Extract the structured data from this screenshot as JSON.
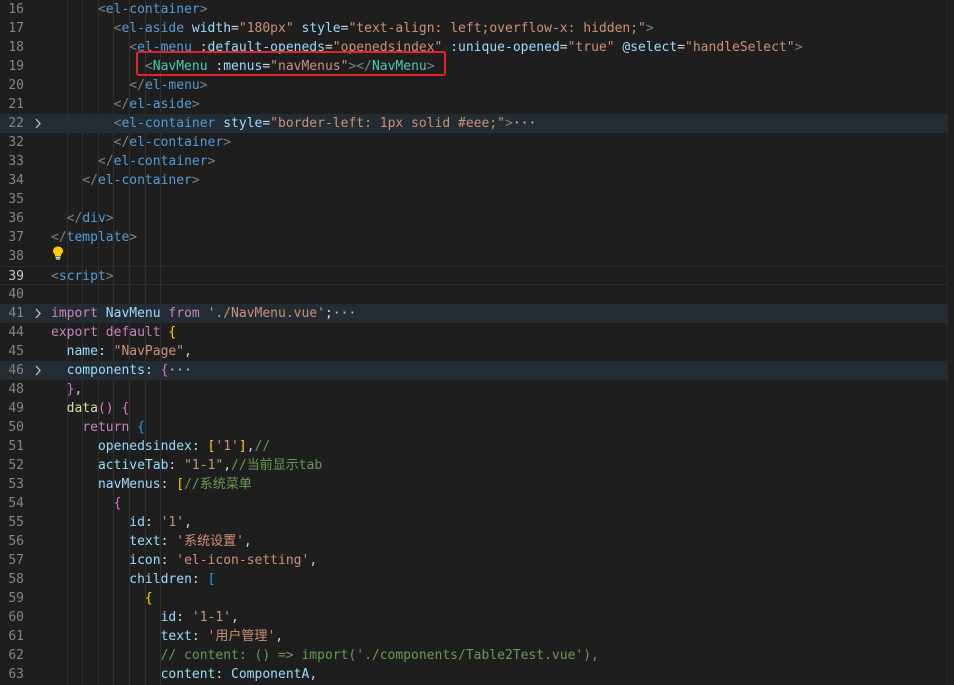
{
  "editor": {
    "lines": [
      {
        "num": "16",
        "fold": "",
        "tokens": [
          [
            "i",
            "      "
          ],
          [
            "br",
            "<"
          ],
          [
            "tag",
            "el-container"
          ],
          [
            "br",
            ">"
          ]
        ]
      },
      {
        "num": "17",
        "fold": "",
        "tokens": [
          [
            "i",
            "        "
          ],
          [
            "br",
            "<"
          ],
          [
            "tag",
            "el-aside"
          ],
          [
            "txt",
            " "
          ],
          [
            "attr",
            "width"
          ],
          [
            "txt",
            "="
          ],
          [
            "str",
            "\"180px\""
          ],
          [
            "txt",
            " "
          ],
          [
            "attr",
            "style"
          ],
          [
            "txt",
            "="
          ],
          [
            "str",
            "\"text-align: left;overflow-x: hidden;\""
          ],
          [
            "br",
            ">"
          ]
        ]
      },
      {
        "num": "18",
        "fold": "",
        "tokens": [
          [
            "i",
            "          "
          ],
          [
            "br",
            "<"
          ],
          [
            "tag",
            "el-menu"
          ],
          [
            "txt",
            " "
          ],
          [
            "attr",
            ":default-openeds"
          ],
          [
            "txt",
            "="
          ],
          [
            "str",
            "\"openedsindex\""
          ],
          [
            "txt",
            " "
          ],
          [
            "attr",
            ":unique-opened"
          ],
          [
            "txt",
            "="
          ],
          [
            "str",
            "\"true\""
          ],
          [
            "txt",
            " "
          ],
          [
            "attr",
            "@select"
          ],
          [
            "txt",
            "="
          ],
          [
            "str",
            "\"handleSelect\""
          ],
          [
            "br",
            ">"
          ]
        ]
      },
      {
        "num": "19",
        "fold": "",
        "tokens": [
          [
            "i",
            "            "
          ],
          [
            "br",
            "<"
          ],
          [
            "cls",
            "NavMenu"
          ],
          [
            "txt",
            " "
          ],
          [
            "attr",
            ":menus"
          ],
          [
            "txt",
            "="
          ],
          [
            "str",
            "\"navMenus\""
          ],
          [
            "br",
            "></"
          ],
          [
            "cls",
            "NavMenu"
          ],
          [
            "br",
            ">"
          ]
        ]
      },
      {
        "num": "20",
        "fold": "",
        "tokens": [
          [
            "i",
            "          "
          ],
          [
            "br",
            "</"
          ],
          [
            "tag",
            "el-menu"
          ],
          [
            "br",
            ">"
          ]
        ]
      },
      {
        "num": "21",
        "fold": "",
        "tokens": [
          [
            "i",
            "        "
          ],
          [
            "br",
            "</"
          ],
          [
            "tag",
            "el-aside"
          ],
          [
            "br",
            ">"
          ]
        ]
      },
      {
        "num": "22",
        "fold": ">",
        "hl": true,
        "tokens": [
          [
            "i",
            "        "
          ],
          [
            "br",
            "<"
          ],
          [
            "tag",
            "el-container"
          ],
          [
            "txt",
            " "
          ],
          [
            "attr",
            "style"
          ],
          [
            "txt",
            "="
          ],
          [
            "str",
            "\"border-left: 1px solid #eee;\""
          ],
          [
            "br",
            ">"
          ],
          [
            "ell",
            "···"
          ]
        ]
      },
      {
        "num": "32",
        "fold": "",
        "tokens": [
          [
            "i",
            "        "
          ],
          [
            "br",
            "</"
          ],
          [
            "tag",
            "el-container"
          ],
          [
            "br",
            ">"
          ]
        ]
      },
      {
        "num": "33",
        "fold": "",
        "tokens": [
          [
            "i",
            "      "
          ],
          [
            "br",
            "</"
          ],
          [
            "tag",
            "el-container"
          ],
          [
            "br",
            ">"
          ]
        ]
      },
      {
        "num": "34",
        "fold": "",
        "tokens": [
          [
            "i",
            "    "
          ],
          [
            "br",
            "</"
          ],
          [
            "tag",
            "el-container"
          ],
          [
            "br",
            ">"
          ]
        ]
      },
      {
        "num": "35",
        "fold": "",
        "tokens": []
      },
      {
        "num": "36",
        "fold": "",
        "tokens": [
          [
            "i",
            "  "
          ],
          [
            "br",
            "</"
          ],
          [
            "tag",
            "div"
          ],
          [
            "br",
            ">"
          ]
        ]
      },
      {
        "num": "37",
        "fold": "",
        "tokens": [
          [
            "br",
            "</"
          ],
          [
            "tag",
            "template"
          ],
          [
            "br",
            ">"
          ]
        ]
      },
      {
        "num": "38",
        "fold": "",
        "tokens": []
      },
      {
        "num": "39",
        "fold": "",
        "active": true,
        "cursor": true,
        "tokens": [
          [
            "br",
            "<"
          ],
          [
            "tag",
            "script"
          ],
          [
            "br",
            ">"
          ]
        ]
      },
      {
        "num": "40",
        "fold": "",
        "tokens": []
      },
      {
        "num": "41",
        "fold": ">",
        "hl": true,
        "tokens": [
          [
            "kw",
            "import"
          ],
          [
            "txt",
            " "
          ],
          [
            "var",
            "NavMenu"
          ],
          [
            "txt",
            " "
          ],
          [
            "kw",
            "from"
          ],
          [
            "txt",
            " "
          ],
          [
            "str",
            "'./NavMenu.vue'"
          ],
          [
            "txt",
            ";"
          ],
          [
            "ell",
            "···"
          ]
        ]
      },
      {
        "num": "44",
        "fold": "",
        "tokens": [
          [
            "kw",
            "export"
          ],
          [
            "txt",
            " "
          ],
          [
            "kw",
            "default"
          ],
          [
            "txt",
            " "
          ],
          [
            "p1",
            "{"
          ]
        ]
      },
      {
        "num": "45",
        "fold": "",
        "tokens": [
          [
            "i",
            "  "
          ],
          [
            "var",
            "name"
          ],
          [
            "txt",
            ": "
          ],
          [
            "str",
            "\"NavPage\""
          ],
          [
            "txt",
            ","
          ]
        ]
      },
      {
        "num": "46",
        "fold": ">",
        "hl": true,
        "tokens": [
          [
            "i",
            "  "
          ],
          [
            "var",
            "components"
          ],
          [
            "txt",
            ": "
          ],
          [
            "p2",
            "{"
          ],
          [
            "ell",
            "···"
          ]
        ]
      },
      {
        "num": "48",
        "fold": "",
        "tokens": [
          [
            "i",
            "  "
          ],
          [
            "p2",
            "}"
          ],
          [
            "txt",
            ","
          ]
        ]
      },
      {
        "num": "49",
        "fold": "",
        "tokens": [
          [
            "i",
            "  "
          ],
          [
            "fn",
            "data"
          ],
          [
            "p2",
            "()"
          ],
          [
            "txt",
            " "
          ],
          [
            "p2",
            "{"
          ]
        ]
      },
      {
        "num": "50",
        "fold": "",
        "tokens": [
          [
            "i",
            "    "
          ],
          [
            "kw",
            "return"
          ],
          [
            "txt",
            " "
          ],
          [
            "p3",
            "{"
          ]
        ]
      },
      {
        "num": "51",
        "fold": "",
        "tokens": [
          [
            "i",
            "      "
          ],
          [
            "var",
            "openedsindex"
          ],
          [
            "txt",
            ": "
          ],
          [
            "p1",
            "["
          ],
          [
            "str",
            "'1'"
          ],
          [
            "p1",
            "]"
          ],
          [
            "txt",
            ","
          ],
          [
            "cm",
            "//"
          ]
        ]
      },
      {
        "num": "52",
        "fold": "",
        "tokens": [
          [
            "i",
            "      "
          ],
          [
            "var",
            "activeTab"
          ],
          [
            "txt",
            ": "
          ],
          [
            "str",
            "\"1-1\""
          ],
          [
            "txt",
            ","
          ],
          [
            "cm",
            "//当前显示tab"
          ]
        ]
      },
      {
        "num": "53",
        "fold": "",
        "tokens": [
          [
            "i",
            "      "
          ],
          [
            "var",
            "navMenus"
          ],
          [
            "txt",
            ": "
          ],
          [
            "p1",
            "["
          ],
          [
            "cm",
            "//系统菜单"
          ]
        ]
      },
      {
        "num": "54",
        "fold": "",
        "tokens": [
          [
            "i",
            "        "
          ],
          [
            "p2",
            "{"
          ]
        ]
      },
      {
        "num": "55",
        "fold": "",
        "tokens": [
          [
            "i",
            "          "
          ],
          [
            "var",
            "id"
          ],
          [
            "txt",
            ": "
          ],
          [
            "str",
            "'1'"
          ],
          [
            "txt",
            ","
          ]
        ]
      },
      {
        "num": "56",
        "fold": "",
        "tokens": [
          [
            "i",
            "          "
          ],
          [
            "var",
            "text"
          ],
          [
            "txt",
            ": "
          ],
          [
            "str",
            "'系统设置'"
          ],
          [
            "txt",
            ","
          ]
        ]
      },
      {
        "num": "57",
        "fold": "",
        "tokens": [
          [
            "i",
            "          "
          ],
          [
            "var",
            "icon"
          ],
          [
            "txt",
            ": "
          ],
          [
            "str",
            "'el-icon-setting'"
          ],
          [
            "txt",
            ","
          ]
        ]
      },
      {
        "num": "58",
        "fold": "",
        "tokens": [
          [
            "i",
            "          "
          ],
          [
            "var",
            "children"
          ],
          [
            "txt",
            ": "
          ],
          [
            "p3",
            "["
          ]
        ]
      },
      {
        "num": "59",
        "fold": "",
        "tokens": [
          [
            "i",
            "            "
          ],
          [
            "p1",
            "{"
          ]
        ]
      },
      {
        "num": "60",
        "fold": "",
        "tokens": [
          [
            "i",
            "              "
          ],
          [
            "var",
            "id"
          ],
          [
            "txt",
            ": "
          ],
          [
            "str",
            "'1-1'"
          ],
          [
            "txt",
            ","
          ]
        ]
      },
      {
        "num": "61",
        "fold": "",
        "tokens": [
          [
            "i",
            "              "
          ],
          [
            "var",
            "text"
          ],
          [
            "txt",
            ": "
          ],
          [
            "str",
            "'用户管理'"
          ],
          [
            "txt",
            ","
          ]
        ]
      },
      {
        "num": "62",
        "fold": "",
        "tokens": [
          [
            "i",
            "              "
          ],
          [
            "cm",
            "// content: () => import('./components/Table2Test.vue'),"
          ]
        ]
      },
      {
        "num": "63",
        "fold": "",
        "tokens": [
          [
            "i",
            "              "
          ],
          [
            "var",
            "content"
          ],
          [
            "txt",
            ": "
          ],
          [
            "var",
            "ComponentA"
          ],
          [
            "txt",
            ","
          ]
        ]
      }
    ],
    "colors": {
      "background": "#1e1e1e",
      "highlight_box": "#e0252b",
      "folded_line": "#232b33"
    }
  }
}
